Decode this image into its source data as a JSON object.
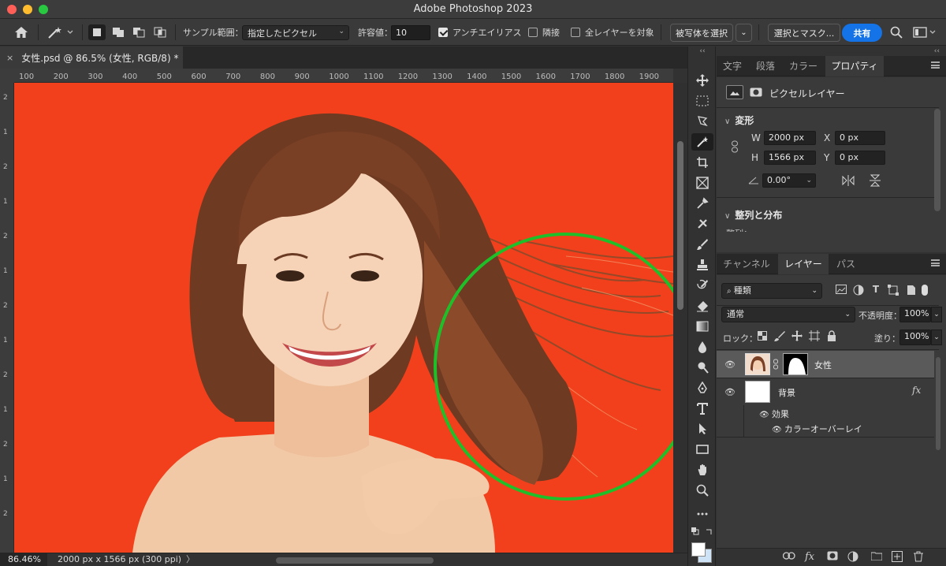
{
  "app": {
    "title": "Adobe Photoshop 2023"
  },
  "options": {
    "sample_label": "サンプル範囲：",
    "sample_value": "指定したピクセル",
    "tolerance_label": "許容値：",
    "tolerance_value": "10",
    "antialias_label": "アンチエイリアス",
    "antialias_checked": true,
    "contiguous_label": "隣接",
    "all_layers_label": "全レイヤーを対象",
    "select_subject": "被写体を選択",
    "select_mask": "選択とマスク...",
    "share": "共有"
  },
  "document": {
    "tab_label": "女性.psd @ 86.5% (女性, RGB/8) *",
    "close": "×",
    "ruler_ticks": [
      "100",
      "200",
      "300",
      "400",
      "500",
      "600",
      "700",
      "800",
      "900",
      "1000",
      "1100",
      "1200",
      "1300",
      "1400",
      "1500",
      "1600",
      "1700",
      "1800",
      "1900"
    ],
    "canvas_color": "#f2401c"
  },
  "status": {
    "zoom": "86.46%",
    "dims": "2000 px x 1566 px (300 ppi)",
    "arrow": "〉"
  },
  "panels": {
    "top_tabs": [
      "文字",
      "段落",
      "カラー",
      "プロパティ"
    ],
    "top_tabs_active": 3,
    "layer_kind": "ピクセルレイヤー",
    "transform_title": "変形",
    "w_label": "W",
    "w_value": "2000 px",
    "h_label": "H",
    "h_value": "1566 px",
    "x_label": "X",
    "x_value": "0 px",
    "y_label": "Y",
    "y_value": "0 px",
    "angle_value": "0.00°",
    "align_title": "整列と分布",
    "align_sub": "整列：",
    "bottom_tabs": [
      "チャンネル",
      "レイヤー",
      "パス"
    ],
    "bottom_tabs_active": 1,
    "filter_label": "種類",
    "blend_mode": "通常",
    "opacity_label": "不透明度：",
    "opacity_value": "100%",
    "lock_label": "ロック：",
    "fill_label": "塗り：",
    "fill_value": "100%",
    "layers": [
      {
        "name": "女性"
      },
      {
        "name": "背景",
        "fx": "fx"
      }
    ],
    "effects_label": "効果",
    "effect_item": "カラーオーバーレイ"
  },
  "colors": {
    "accent": "#1473e6",
    "highlight_circle": "#1fbf2a"
  }
}
